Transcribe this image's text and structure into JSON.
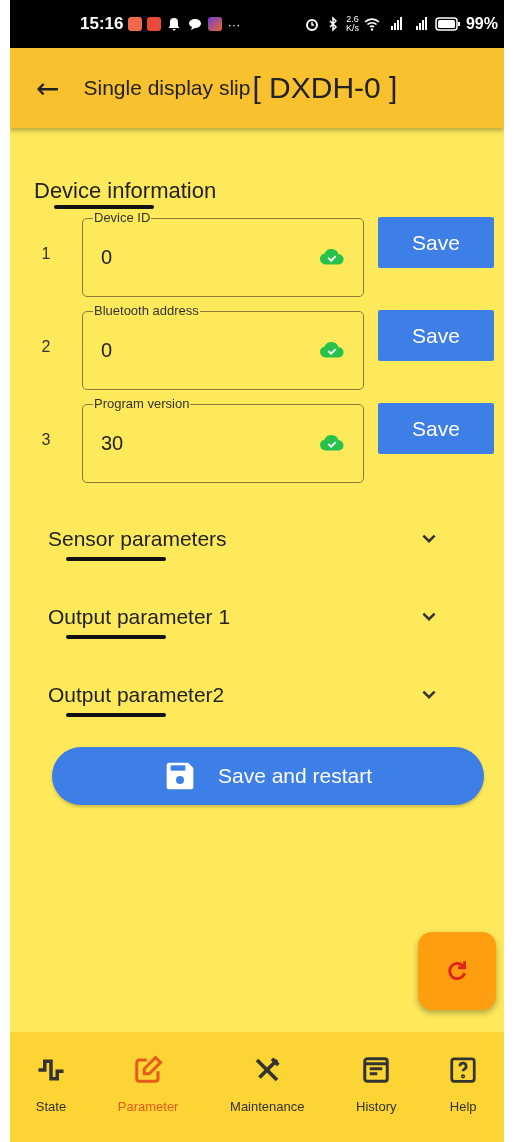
{
  "status_bar": {
    "time": "15:16",
    "more": "···",
    "speed_value": "2.6",
    "speed_unit": "K/s",
    "battery": "99%"
  },
  "header": {
    "back": "←",
    "title": "Single display slip",
    "code": "[ DXDH-0 ]"
  },
  "device_info": {
    "title": "Device information",
    "fields": [
      {
        "index": "1",
        "label": "Device ID",
        "value": "0",
        "synced": true,
        "save": "Save"
      },
      {
        "index": "2",
        "label": "Bluetooth address",
        "value": "0",
        "synced": true,
        "save": "Save"
      },
      {
        "index": "3",
        "label": "Program version",
        "value": "30",
        "synced": true,
        "save": "Save"
      }
    ]
  },
  "sections": [
    {
      "title": "Sensor parameters",
      "expanded": false
    },
    {
      "title": "Output parameter 1",
      "expanded": false
    },
    {
      "title": "Output parameter2",
      "expanded": false
    }
  ],
  "save_restart": "Save and restart",
  "fab": {
    "kind": "refresh"
  },
  "nav": [
    {
      "kind": "state",
      "label": "State",
      "selected": false
    },
    {
      "kind": "edit",
      "label": "Parameter",
      "selected": true
    },
    {
      "kind": "tools",
      "label": "Maintenance",
      "selected": false
    },
    {
      "kind": "history",
      "label": "History",
      "selected": false
    },
    {
      "kind": "help",
      "label": "Help",
      "selected": false
    }
  ]
}
